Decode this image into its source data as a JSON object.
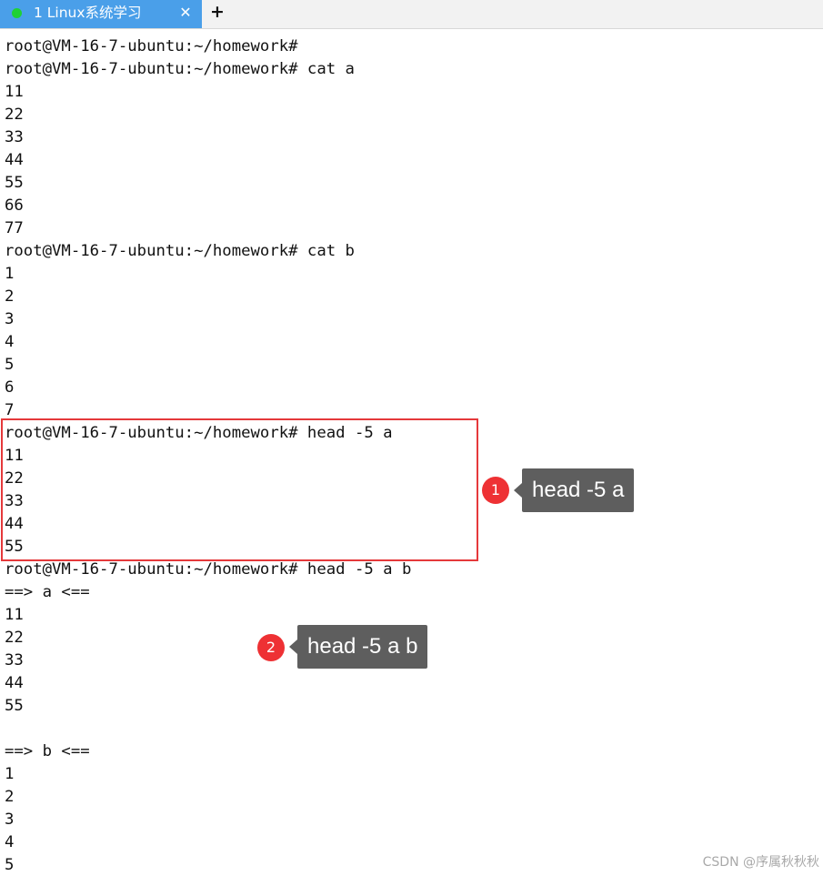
{
  "tabbar": {
    "tab": {
      "label": "1 Linux系统学习",
      "close_glyph": "✕",
      "status_color": "#1fd134"
    },
    "new_tab_glyph": "+"
  },
  "terminal": {
    "lines": [
      "root@VM-16-7-ubuntu:~/homework#",
      "root@VM-16-7-ubuntu:~/homework# cat a",
      "11",
      "22",
      "33",
      "44",
      "55",
      "66",
      "77",
      "root@VM-16-7-ubuntu:~/homework# cat b",
      "1",
      "2",
      "3",
      "4",
      "5",
      "6",
      "7",
      "root@VM-16-7-ubuntu:~/homework# head -5 a",
      "11",
      "22",
      "33",
      "44",
      "55",
      "root@VM-16-7-ubuntu:~/homework# head -5 a b",
      "==> a <==",
      "11",
      "22",
      "33",
      "44",
      "55",
      "",
      "==> b <==",
      "1",
      "2",
      "3",
      "4",
      "5"
    ]
  },
  "annotations": [
    {
      "number": "1",
      "text": "head -5 a"
    },
    {
      "number": "2",
      "text": "head -5 a b"
    }
  ],
  "watermark": "CSDN @序属秋秋秋",
  "colors": {
    "tab_active": "#4a9fe9",
    "highlight_border": "#e5393b",
    "marker": "#ee3134",
    "callout_bg": "#5e5e5e"
  }
}
